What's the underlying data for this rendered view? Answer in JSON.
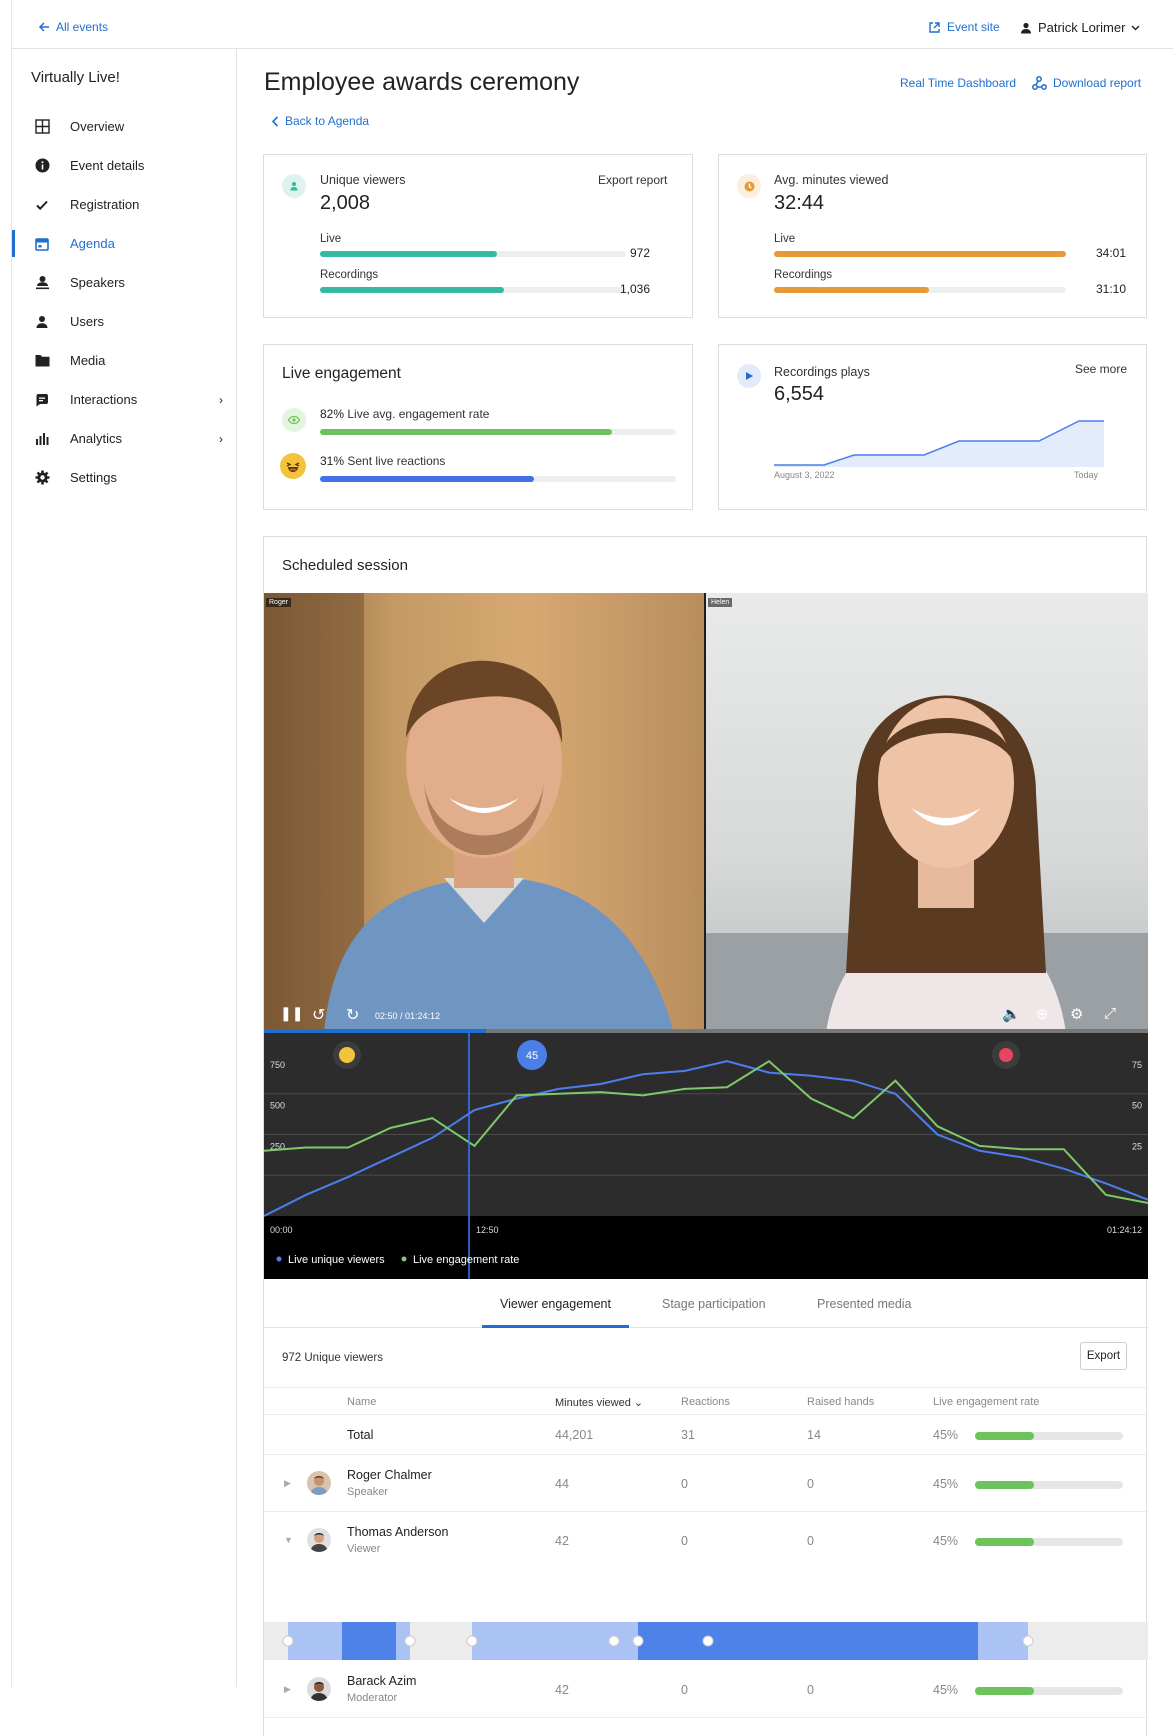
{
  "topbar": {
    "back": "All events",
    "event_site": "Event site",
    "user": "Patrick Lorimer"
  },
  "sidebar": {
    "title": "Virtually Live!",
    "items": [
      {
        "label": "Overview",
        "icon": "grid-icon"
      },
      {
        "label": "Event details",
        "icon": "info-icon"
      },
      {
        "label": "Registration",
        "icon": "check-icon"
      },
      {
        "label": "Agenda",
        "icon": "calendar-icon",
        "active": true
      },
      {
        "label": "Speakers",
        "icon": "speaker-icon"
      },
      {
        "label": "Users",
        "icon": "user-icon"
      },
      {
        "label": "Media",
        "icon": "folder-icon"
      },
      {
        "label": "Interactions",
        "icon": "chat-icon",
        "chevron": true
      },
      {
        "label": "Analytics",
        "icon": "bar-chart-icon",
        "chevron": true
      },
      {
        "label": "Settings",
        "icon": "gear-icon"
      }
    ]
  },
  "header": {
    "title": "Employee awards ceremony",
    "realtime": "Real Time Dashboard",
    "download": "Download report",
    "back": "Back to Agenda"
  },
  "viewers": {
    "label": "Unique viewers",
    "value": "2,008",
    "export": "Export report",
    "live_label": "Live",
    "live_value": "972",
    "rec_label": "Recordings",
    "rec_value": "1,036",
    "live_frac": 0.58,
    "rec_frac": 0.6
  },
  "minutes": {
    "label": "Avg. minutes viewed",
    "value": "32:44",
    "live_label": "Live",
    "live_value": "34:01",
    "rec_label": "Recordings",
    "rec_value": "31:10",
    "live_frac": 1.0,
    "rec_frac": 0.53
  },
  "engagement": {
    "title": "Live engagement",
    "rate_pct": "82%",
    "rate_label": "Live avg. engagement rate",
    "react_pct": "31%",
    "react_label": "Sent live reactions",
    "rate_frac": 0.82,
    "react_frac": 0.6
  },
  "plays": {
    "label": "Recordings plays",
    "value": "6,554",
    "see_more": "See more",
    "start": "August 3, 2022",
    "end": "Today"
  },
  "session": {
    "title": "Scheduled session",
    "speaker_left": "Roger",
    "speaker_right": "Helen",
    "time": "02:50 / 01:24:12",
    "marker": "45",
    "cursor": "12:50",
    "t_start": "00:00",
    "t_end": "01:24:12",
    "legend": [
      "Live unique viewers",
      "Live engagement rate"
    ]
  },
  "chart_data": {
    "type": "line",
    "x_range": [
      "00:00",
      "01:24:12"
    ],
    "left_axis": [
      250,
      500,
      750
    ],
    "right_axis": [
      25,
      50,
      75
    ],
    "series": [
      {
        "name": "Live unique viewers",
        "color": "#4c7ef0",
        "values": [
          0,
          130,
          240,
          360,
          480,
          650,
          720,
          780,
          810,
          870,
          890,
          950,
          880,
          860,
          830,
          750,
          500,
          400,
          360,
          290,
          200,
          100
        ]
      },
      {
        "name": "Live engagement rate",
        "color": "#7ec968",
        "values": [
          400,
          420,
          420,
          540,
          600,
          430,
          740,
          750,
          760,
          740,
          780,
          790,
          950,
          720,
          600,
          830,
          550,
          430,
          410,
          410,
          130,
          80
        ]
      }
    ]
  },
  "tabs": [
    "Viewer engagement",
    "Stage participation",
    "Presented media"
  ],
  "table": {
    "count": "972 Unique viewers",
    "export": "Export",
    "headers": [
      "Name",
      "Minutes viewed",
      "Reactions",
      "Raised hands",
      "Live engagement rate"
    ],
    "total": {
      "name": "Total",
      "minutes": "44,201",
      "reactions": "31",
      "hands": "14",
      "rate": "45%",
      "frac": 0.4
    },
    "rows": [
      {
        "name": "Roger Chalmer",
        "role": "Speaker",
        "minutes": "44",
        "reactions": "0",
        "hands": "0",
        "rate": "45%",
        "frac": 0.4
      },
      {
        "name": "Thomas Anderson",
        "role": "Viewer",
        "minutes": "42",
        "reactions": "0",
        "hands": "0",
        "rate": "45%",
        "frac": 0.4
      },
      {
        "name": "Barack Azim",
        "role": "Moderator",
        "minutes": "42",
        "reactions": "0",
        "hands": "0",
        "rate": "45%",
        "frac": 0.4
      }
    ]
  },
  "colors": {
    "accent": "#1f6fd1",
    "teal": "#35b9a0",
    "orange": "#e39a37",
    "green": "#6cc35b",
    "blue": "#4471e6"
  }
}
